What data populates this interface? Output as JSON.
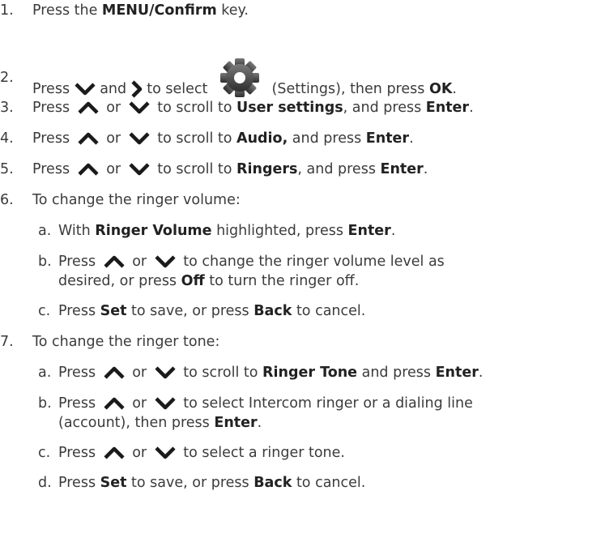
{
  "steps": [
    {
      "n": "1.",
      "pre": "Press the ",
      "b1": "MENU/Confirm",
      "post": " key."
    },
    {
      "n": "2.",
      "t1": "Press ",
      "t2": " and ",
      "t3": " to select ",
      "t4": " (Settings), then press ",
      "b1": "OK",
      "t5": "."
    },
    {
      "n": "3.",
      "t1": "Press ",
      "t2": " or ",
      "t3": " to scroll to ",
      "b1": "User settings",
      "t4": ", and press ",
      "b2": "Enter",
      "t5": "."
    },
    {
      "n": "4.",
      "t1": "Press ",
      "t2": " or ",
      "t3": " to scroll to ",
      "b1": "Audio,",
      "t4": " and press ",
      "b2": "Enter",
      "t5": "."
    },
    {
      "n": "5.",
      "t1": "Press ",
      "t2": " or ",
      "t3": " to scroll to ",
      "b1": "Ringers",
      "t4": ", and press ",
      "b2": "Enter",
      "t5": "."
    },
    {
      "n": "6.",
      "text": "To change the ringer volume:"
    },
    {
      "n": "7.",
      "text": "To change the ringer tone:"
    }
  ],
  "sub6": [
    {
      "l": "a.",
      "t1": "With ",
      "b1": "Ringer Volume",
      "t2": " highlighted, press ",
      "b2": "Enter",
      "t3": "."
    },
    {
      "l": "b.",
      "t1": "Press ",
      "t2": " or ",
      "t3": " to change the ringer volume level as",
      "cont1": "desired, or press ",
      "cb1": "Off",
      "cont2": " to turn the ringer off."
    },
    {
      "l": "c.",
      "t1": "Press ",
      "b1": "Set",
      "t2": " to save, or press ",
      "b2": "Back",
      "t3": " to cancel."
    }
  ],
  "sub7": [
    {
      "l": "a.",
      "t1": "Press ",
      "t2": " or ",
      "t3": " to scroll to ",
      "b1": "Ringer Tone",
      "t4": " and press ",
      "b2": "Enter",
      "t5": "."
    },
    {
      "l": "b.",
      "t1": "Press ",
      "t2": " or ",
      "t3": " to select Intercom ringer or a dialing line",
      "cont1": "(account), then press ",
      "cb1": "Enter",
      "cont2": "."
    },
    {
      "l": "c.",
      "t1": "Press ",
      "t2": " or ",
      "t3": " to select a ringer tone."
    },
    {
      "l": "d.",
      "t1": "Press ",
      "b1": "Set",
      "t2": " to save, or press ",
      "b2": "Back",
      "t3": " to cancel."
    }
  ],
  "icons": {
    "up": "chevron-up-icon",
    "down": "chevron-down-icon",
    "right": "chevron-right-icon",
    "settings": "settings-gear-icon"
  },
  "colors": {
    "text": "#3b3b3b",
    "icon": "#1a1a1a"
  }
}
